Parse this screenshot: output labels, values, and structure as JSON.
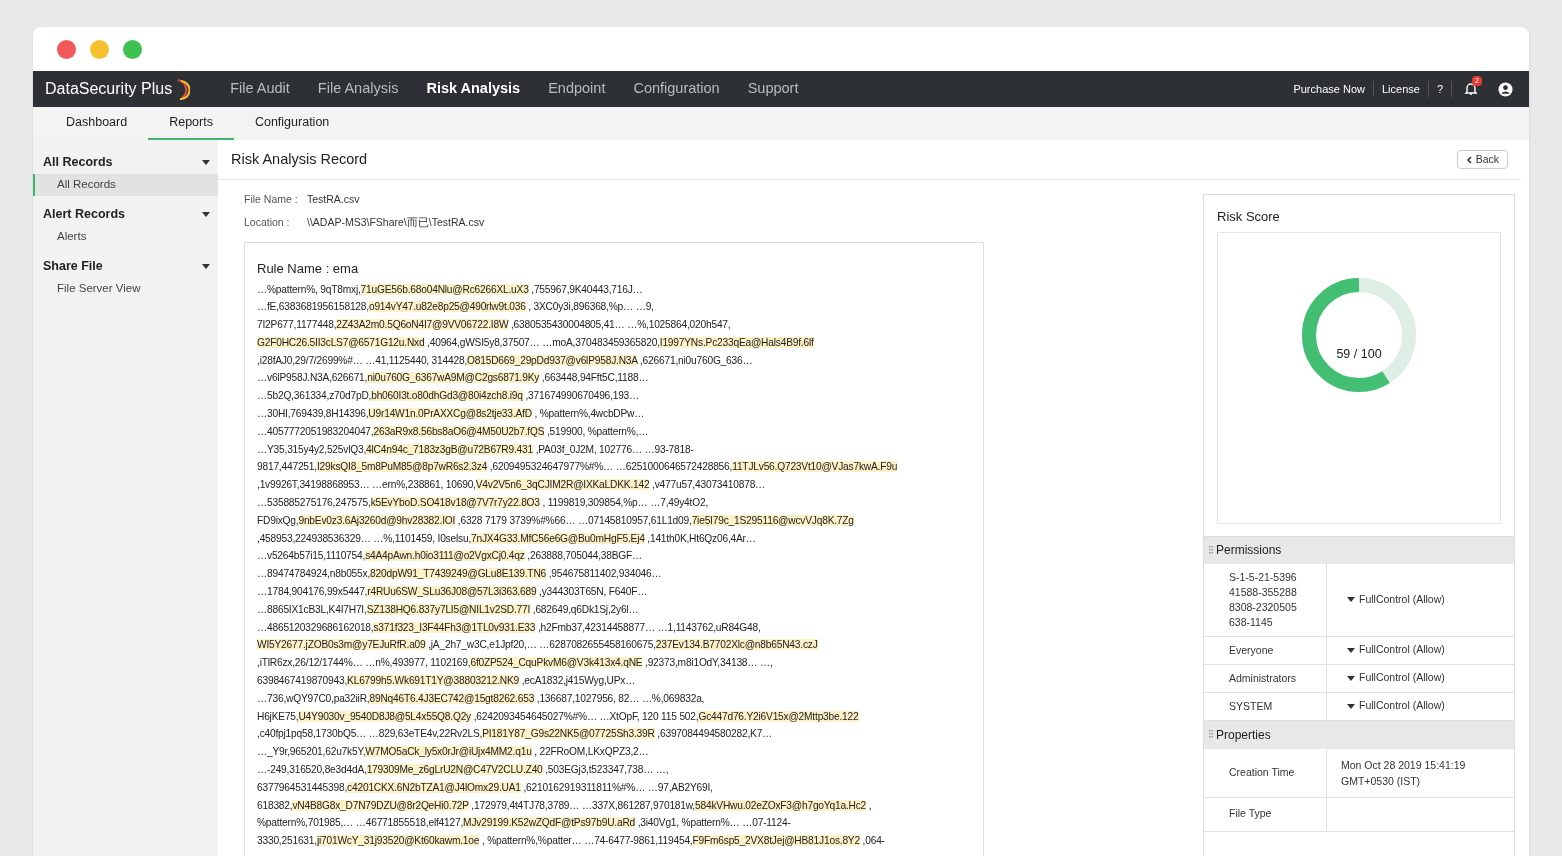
{
  "brand": "DataSecurity Plus",
  "nav": [
    {
      "label": "File Audit",
      "selected": false
    },
    {
      "label": "File Analysis",
      "selected": false
    },
    {
      "label": "Risk Analysis",
      "selected": true
    },
    {
      "label": "Endpoint",
      "selected": false
    },
    {
      "label": "Configuration",
      "selected": false
    },
    {
      "label": "Support",
      "selected": false
    }
  ],
  "top_links": [
    "Purchase Now",
    "License",
    "?"
  ],
  "notification_count": "2",
  "subtabs": [
    {
      "label": "Dashboard",
      "selected": false
    },
    {
      "label": "Reports",
      "selected": true
    },
    {
      "label": "Configuration",
      "selected": false
    }
  ],
  "sidebar": [
    {
      "label": "All Records",
      "children": [
        {
          "label": "All Records",
          "selected": true
        }
      ]
    },
    {
      "label": "Alert Records",
      "children": [
        {
          "label": "Alerts",
          "selected": false
        }
      ]
    },
    {
      "label": "Share File",
      "children": [
        {
          "label": "File Server View",
          "selected": false
        }
      ]
    }
  ],
  "page_title": "Risk Analysis Record",
  "back_button": "Back",
  "fields": [
    {
      "label": "File Name :",
      "value": "TestRA.csv"
    },
    {
      "label": "Location :",
      "value": "\\\\ADAP-MS3\\FShare\\而已\\TestRA.csv"
    }
  ],
  "rule_title": "Rule Name : ema",
  "record_lines": [
    [
      {
        "text": "…%pattern%, 9qT8mxj,",
        "highlighted": false
      },
      {
        "text": "71uGE56b.68o04Nlu@Rc6266XL.uX3",
        "highlighted": true
      },
      {
        "text": " ,755967,9K40443,716J…",
        "highlighted": false
      }
    ],
    [
      {
        "text": "…fE,6383681956158128,",
        "highlighted": false
      },
      {
        "text": "o914vY47.u82e8p25@490rlw9t.036",
        "highlighted": true
      },
      {
        "text": " , 3XC0y3i,896368,%p… …9,",
        "highlighted": false
      }
    ],
    [
      {
        "text": "7I2P677,1177448,",
        "highlighted": false
      },
      {
        "text": "2Z43A2m0.5Q6oN4I7@9VV06722.I8W",
        "highlighted": true
      },
      {
        "text": " ,6380535430004805,41… …%,1025864,020h547,",
        "highlighted": false
      }
    ],
    [
      {
        "text": "G2F0HC26.5II3cLS7@6571G12u.Nxd",
        "highlighted": true
      },
      {
        "text": " ,40964,gWSI5y8,37507… …moA,370483459365820,",
        "highlighted": false
      },
      {
        "text": "I1997YNs.Pc233qEa@Hals4B9f.6lf",
        "highlighted": true
      }
    ],
    [
      {
        "text": ",i28fAJ0,29/7/2699%#… …41,1125440, 314428,",
        "highlighted": false
      },
      {
        "text": "O815D669_29pDd937@v6lP958J.N3A",
        "highlighted": true
      },
      {
        "text": " ,626671,ni0u760G_636…",
        "highlighted": false
      }
    ],
    [
      {
        "text": "…v6lP958J.N3A,626671,",
        "highlighted": false
      },
      {
        "text": "ni0u760G_6367wA9M@C2gs6871.9Ky",
        "highlighted": true
      },
      {
        "text": " ,663448,94Fft5C,1188…",
        "highlighted": false
      }
    ],
    [
      {
        "text": "…5b2Q,361334,z70d7pD,",
        "highlighted": false
      },
      {
        "text": "bh060I3t.o80dhGd3@80i4zch8.i9q",
        "highlighted": true
      },
      {
        "text": " ,371674990670496,193…",
        "highlighted": false
      }
    ],
    [
      {
        "text": "…30HI,769439,8H14396,",
        "highlighted": false
      },
      {
        "text": "U9r14W1n.0PrAXXCg@8s2tje33.AfD",
        "highlighted": true
      },
      {
        "text": " , %pattern%,4wcbDPw…",
        "highlighted": false
      }
    ],
    [
      {
        "text": "…4057772051983204047,",
        "highlighted": false
      },
      {
        "text": "263aR9x8.56bs8aO6@4M50U2b7.fQS",
        "highlighted": true
      },
      {
        "text": " ,519900, %pattern%,…",
        "highlighted": false
      }
    ],
    [
      {
        "text": "…Y35,315y4y2,525vlQ3,",
        "highlighted": false
      },
      {
        "text": "4lC4n94c_7183z3gB@u72B67R9.431",
        "highlighted": true
      },
      {
        "text": " ,PA03f_0J2M, 102776… …93-7818-",
        "highlighted": false
      }
    ],
    [
      {
        "text": "9817,447251,",
        "highlighted": false
      },
      {
        "text": "I29ksQI8_5m8PuM85@8p7wR6s2.3z4",
        "highlighted": true
      },
      {
        "text": " ,6209495324647977%#%… …6251000646572428856,",
        "highlighted": false
      },
      {
        "text": "11TJLv56.Q723Vt10@VJas7kwA.F9u",
        "highlighted": true
      }
    ],
    [
      {
        "text": ",1v9926T,34198868953… …ern%,238861, 10690,",
        "highlighted": false
      },
      {
        "text": "V4v2V5n6_3qCJIM2R@IXKaLDKK.142",
        "highlighted": true
      },
      {
        "text": " ,v477u57,43073410878…",
        "highlighted": false
      }
    ],
    [
      {
        "text": "…535885275176,247575,",
        "highlighted": false
      },
      {
        "text": "k5EvYboD.SO418v18@7V7r7y22.8O3",
        "highlighted": true
      },
      {
        "text": " , 1199819,309854,%p… …7,49y4tO2,",
        "highlighted": false
      }
    ],
    [
      {
        "text": "FD9ixQg,",
        "highlighted": false
      },
      {
        "text": "9nbEv0z3.6Aj3260d@9hv28382.IOI",
        "highlighted": true
      },
      {
        "text": " ,6328 7179 3739%#%66… …07145810957,61L1d09,",
        "highlighted": false
      },
      {
        "text": "7ie5I79c_1S295116@wcvVJq8K.7Zg",
        "highlighted": true
      }
    ],
    [
      {
        "text": ",458953,224938536329… …%,1101459, I0selsu,",
        "highlighted": false
      },
      {
        "text": "7nJX4G33.MfC56e6G@Bu0mHgF5.Ej4",
        "highlighted": true
      },
      {
        "text": " ,141th0K,Ht6Qz06,4Ar…",
        "highlighted": false
      }
    ],
    [
      {
        "text": "…v5264b57i15,1110754,",
        "highlighted": false
      },
      {
        "text": "s4A4pAwn.h0io3111@o2VgxCj0.4qz",
        "highlighted": true
      },
      {
        "text": " ,263888,705044,38BGF…",
        "highlighted": false
      }
    ],
    [
      {
        "text": "…89474784924,n8b055x,",
        "highlighted": false
      },
      {
        "text": "820dpW91_T7439249@GLu8E139.TN6",
        "highlighted": true
      },
      {
        "text": " ,954675811402,934046…",
        "highlighted": false
      }
    ],
    [
      {
        "text": "…1784,904176,99x5447,",
        "highlighted": false
      },
      {
        "text": "r4RUu6SW_SLu36J08@57L3i363.689",
        "highlighted": true
      },
      {
        "text": " ,y344303T65N, F640F…",
        "highlighted": false
      }
    ],
    [
      {
        "text": "…8865IX1cB3L,K4I7H7I,",
        "highlighted": false
      },
      {
        "text": "SZ138HQ6.837y7LI5@NIL1v2SD.77I",
        "highlighted": true
      },
      {
        "text": " ,682649,q6Dk1Sj,2y6l…",
        "highlighted": false
      }
    ],
    [
      {
        "text": "…4865120329686162018,",
        "highlighted": false
      },
      {
        "text": "s371f323_I3F44Fh3@1TL0v931.E33",
        "highlighted": true
      },
      {
        "text": " ,h2Fmb37,42314458877… …1,1143762,uR84G48,",
        "highlighted": false
      }
    ],
    [
      {
        "text": "WI5Y2677.jZOB0s3m@y7EJuRfR.a09",
        "highlighted": true
      },
      {
        "text": " ,jA_2h7_w3C,e1Jpf20,… …6287082655458160675,",
        "highlighted": false
      },
      {
        "text": "237Ev134.B7702Xlc@n8b65N43.czJ",
        "highlighted": true
      }
    ],
    [
      {
        "text": ",iTlR6zx,26/12/1744%… …n%,493977, 1102169,",
        "highlighted": false
      },
      {
        "text": "6f0ZP524_CquPkvM6@V3k413x4.qNE",
        "highlighted": true
      },
      {
        "text": " ,92373,m8i1OdY,34138… …,",
        "highlighted": false
      }
    ],
    [
      {
        "text": "6398467419870943,",
        "highlighted": false
      },
      {
        "text": "KL6799h5.Wk691T1Y@38803212.NK9",
        "highlighted": true
      },
      {
        "text": " ,ecA1832,j415Wyg,UPx…",
        "highlighted": false
      }
    ],
    [
      {
        "text": "…736,wQY97C0,pa32iiR,",
        "highlighted": false
      },
      {
        "text": "89Nq46T6.4J3EC742@15gt8262.653",
        "highlighted": true
      },
      {
        "text": " ,136687,1027956, 82… …%,069832a,",
        "highlighted": false
      }
    ],
    [
      {
        "text": "H6jKE75,",
        "highlighted": false
      },
      {
        "text": "U4Y9030v_9540D8J8@5L4x55Q8.Q2y",
        "highlighted": true
      },
      {
        "text": " ,6242093454645027%#%… …XtOpF, 120 115 502,",
        "highlighted": false
      },
      {
        "text": "Gc447d76.Y2i6V15x@2Mttp3be.122",
        "highlighted": true
      }
    ],
    [
      {
        "text": ",c40fpj1pq58,1730bQ5… …829,63eTE4v,22Rv2LS,",
        "highlighted": false
      },
      {
        "text": "PI181Y87_G9s22NK5@07725Sh3.39R",
        "highlighted": true
      },
      {
        "text": " ,6397084494580282,K7…",
        "highlighted": false
      }
    ],
    [
      {
        "text": "…_Y9r,965201,62u7k5Y,",
        "highlighted": false
      },
      {
        "text": "W7MO5aCk_ly5x0rJr@iUjx4MM2.q1u",
        "highlighted": true
      },
      {
        "text": " , 22FRoOM,LKxQPZ3,2…",
        "highlighted": false
      }
    ],
    [
      {
        "text": "…-249,316520,8e3d4dA,",
        "highlighted": false
      },
      {
        "text": "179309Me_z6gLrU2N@C47V2CLU.Z40",
        "highlighted": true
      },
      {
        "text": " ,503EGj3,t523347,738… …,",
        "highlighted": false
      }
    ],
    [
      {
        "text": "6377964531445398,",
        "highlighted": false
      },
      {
        "text": "c4201CKX.6N2bTZA1@J4lOmx29.UA1",
        "highlighted": true
      },
      {
        "text": " ,6210162919311811%#%… …97,AB2Y69I,",
        "highlighted": false
      }
    ],
    [
      {
        "text": "618382,",
        "highlighted": false
      },
      {
        "text": "vN4B8G8x_D7N79DZU@8r2QeHi0.72P",
        "highlighted": true
      },
      {
        "text": " ,172979,4t4TJ78,3789… …337X,861287,970181w,",
        "highlighted": false
      },
      {
        "text": "584kVHwu.02eZOxF3@h7goYq1a.Hc2",
        "highlighted": true
      },
      {
        "text": " ,",
        "highlighted": false
      }
    ],
    [
      {
        "text": "%pattern%,701985,… …46771855518,elf4127,",
        "highlighted": false
      },
      {
        "text": "MJv29199.K52wZQdF@tPs97b9U.aRd",
        "highlighted": true
      },
      {
        "text": " ,3i40Vg1, %pattern%… …07-1124-",
        "highlighted": false
      }
    ],
    [
      {
        "text": "3330,251631,",
        "highlighted": false
      },
      {
        "text": "ji701WcY_31j93520@Kt60kawm.1oe",
        "highlighted": true
      },
      {
        "text": " , %pattern%,%patter… …74-6477-9861,119454,",
        "highlighted": false
      },
      {
        "text": "F9Fm6sp5_2VX8tJej@HB81J1os.8Y2",
        "highlighted": true
      },
      {
        "text": " ,064-",
        "highlighted": false
      }
    ]
  ],
  "risk_score": {
    "title": "Risk Score",
    "reading": "59 / 100",
    "level": 0.59
  },
  "permissions": {
    "title": "Permissions",
    "rows": [
      {
        "principal": "S-1-5-21-539641588-3552888308-2320505638-1145",
        "access": "FullControl (Allow)"
      },
      {
        "principal": "Everyone",
        "access": "FullControl (Allow)"
      },
      {
        "principal": "Administrators",
        "access": "FullControl (Allow)"
      },
      {
        "principal": "SYSTEM",
        "access": "FullControl (Allow)"
      }
    ]
  },
  "properties": {
    "title": "Properties",
    "rows": [
      {
        "name": "Creation Time",
        "value": "Mon Oct 28 2019 15:41:19 GMT+0530 (IST)"
      },
      {
        "name": "File Type"
      }
    ]
  }
}
